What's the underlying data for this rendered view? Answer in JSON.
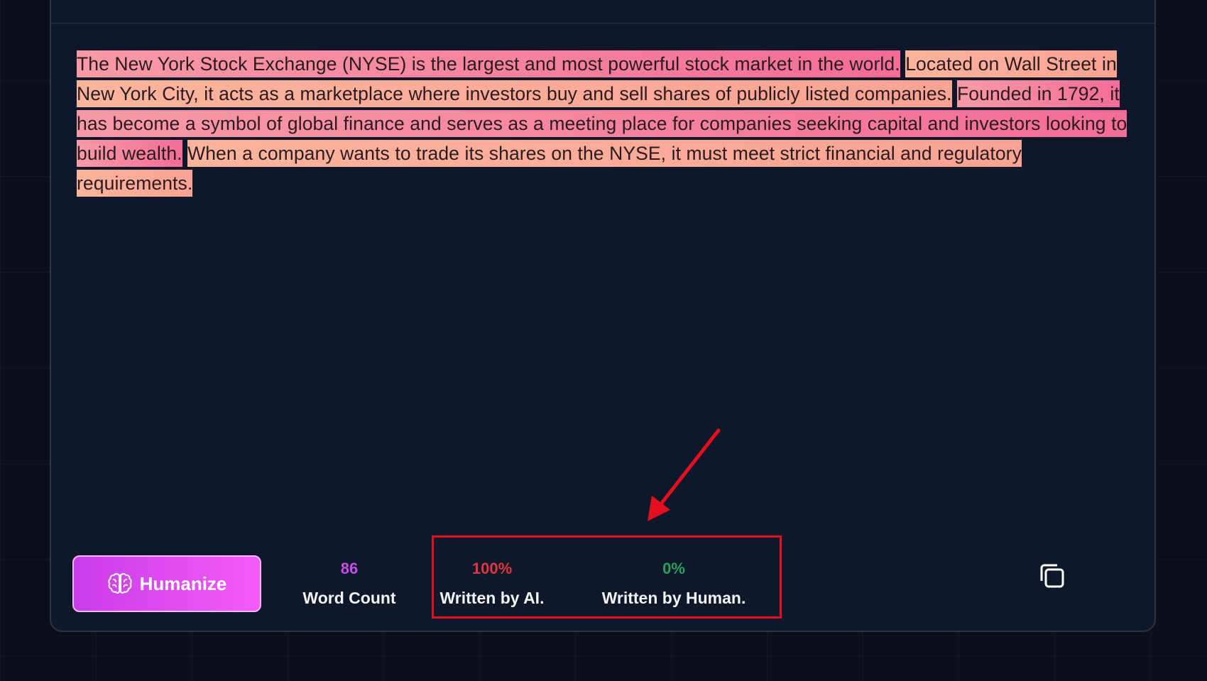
{
  "detector": {
    "segments": [
      {
        "text": "The New York Stock Exchange (NYSE) is the largest and most powerful stock market in the world.",
        "tone": "pink"
      },
      {
        "text": "Located on Wall Street in New York City, it acts as a marketplace where investors buy and sell shares of publicly listed companies.",
        "tone": "peach"
      },
      {
        "text": "Founded in 1792, it has become a symbol of global finance and serves as a meeting place for companies seeking capital and investors looking to build wealth.",
        "tone": "pink"
      },
      {
        "text": "When a company wants to trade its shares on the NYSE, it must meet strict financial and regulatory requirements.",
        "tone": "peach"
      }
    ]
  },
  "footer": {
    "humanize_label": "Humanize",
    "word_count_value": "86",
    "word_count_label": "Word Count",
    "ai_value": "100%",
    "ai_label": "Written by AI.",
    "human_value": "0%",
    "human_label": "Written by Human."
  },
  "colors": {
    "word_count": "#c84fe6",
    "ai": "#e0373f",
    "human": "#22a35a",
    "annotation": "#e4101f"
  },
  "icons": {
    "humanize": "brain-icon",
    "copy": "copy-icon"
  }
}
